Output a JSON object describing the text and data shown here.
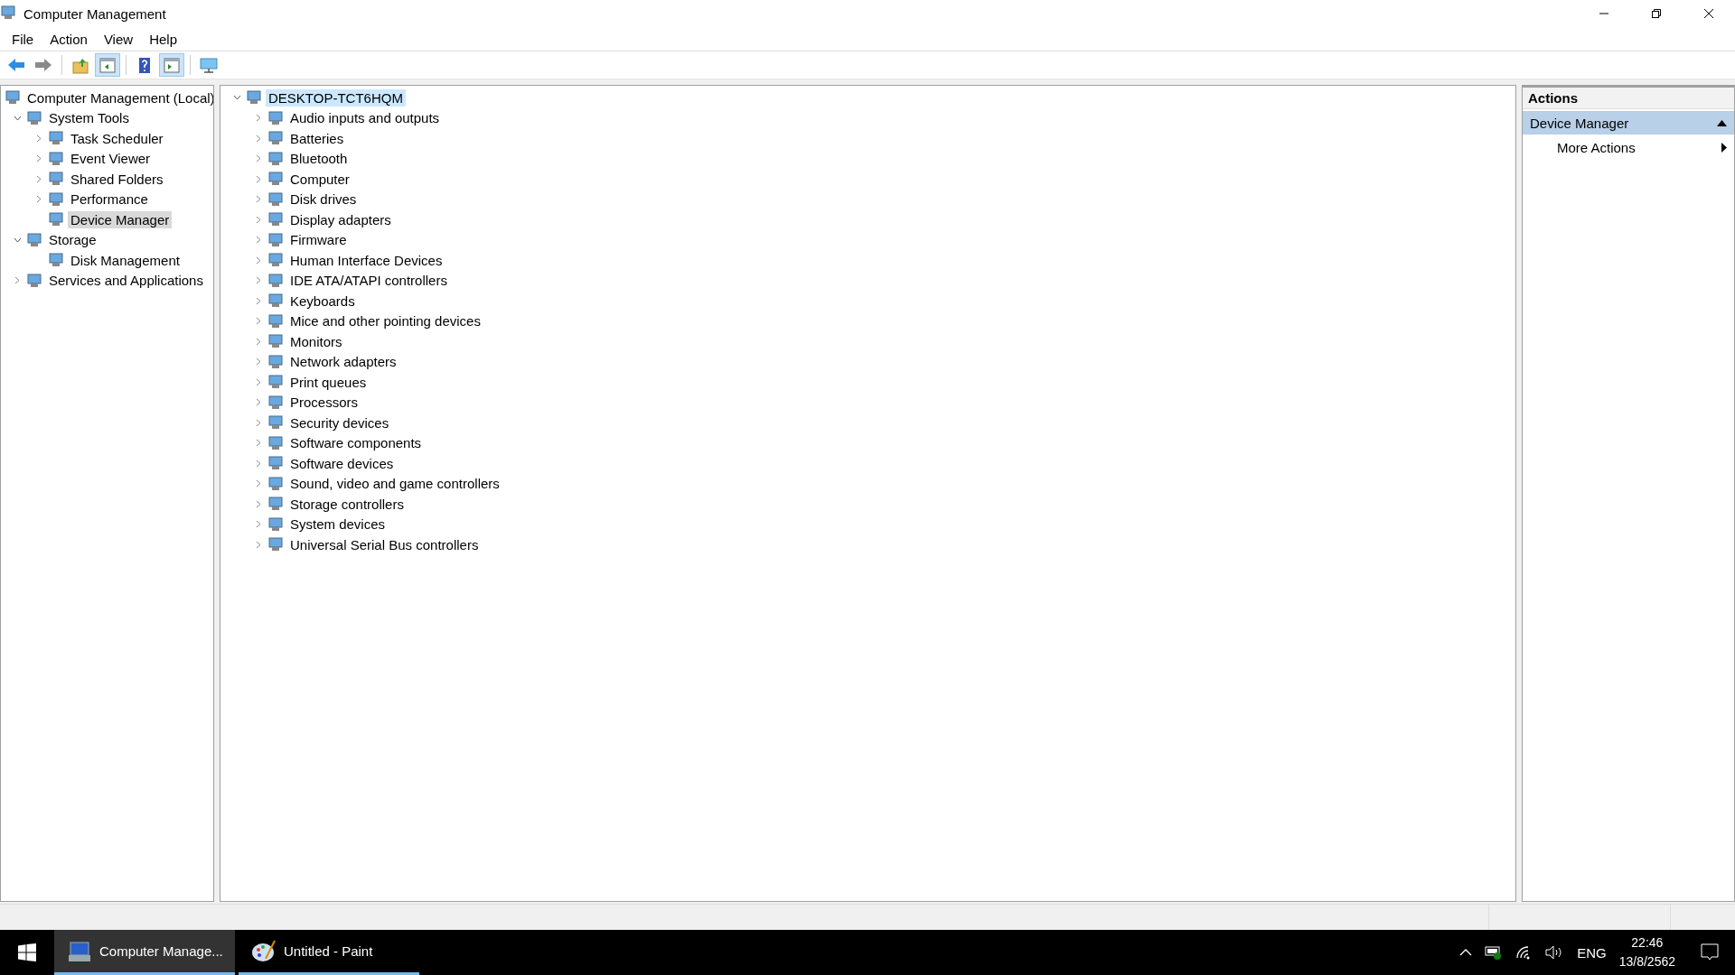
{
  "window": {
    "title": "Computer Management"
  },
  "menu": [
    "File",
    "Action",
    "View",
    "Help"
  ],
  "toolbar": [
    {
      "kind": "back",
      "pressed": false
    },
    {
      "kind": "forward",
      "pressed": false
    },
    {
      "kind": "up",
      "pressed": false
    },
    {
      "kind": "console-tree",
      "pressed": true
    },
    {
      "kind": "help",
      "pressed": false
    },
    {
      "kind": "action-pane",
      "pressed": true
    },
    {
      "kind": "monitor",
      "pressed": false
    }
  ],
  "console_tree": [
    {
      "label": "Computer Management (Local)",
      "selected": false,
      "children": [
        {
          "label": "System Tools",
          "expanded": true,
          "selected": false,
          "children": [
            {
              "label": "Task Scheduler",
              "expanded": false,
              "selected": false
            },
            {
              "label": "Event Viewer",
              "expanded": false,
              "selected": false
            },
            {
              "label": "Shared Folders",
              "expanded": false,
              "selected": false
            },
            {
              "label": "Performance",
              "expanded": false,
              "selected": false
            },
            {
              "label": "Device Manager",
              "selected": true
            }
          ]
        },
        {
          "label": "Storage",
          "expanded": true,
          "selected": false,
          "children": [
            {
              "label": "Disk Management",
              "selected": false
            }
          ]
        },
        {
          "label": "Services and Applications",
          "expanded": false,
          "selected": false
        }
      ]
    }
  ],
  "device_tree": [
    {
      "label": "DESKTOP-TCT6HQM",
      "expanded": true,
      "selected": true,
      "children": [
        {
          "label": "Audio inputs and outputs",
          "expanded": false,
          "selected": false
        },
        {
          "label": "Batteries",
          "expanded": false,
          "selected": false
        },
        {
          "label": "Bluetooth",
          "expanded": false,
          "selected": false
        },
        {
          "label": "Computer",
          "expanded": false,
          "selected": false
        },
        {
          "label": "Disk drives",
          "expanded": false,
          "selected": false
        },
        {
          "label": "Display adapters",
          "expanded": false,
          "selected": false
        },
        {
          "label": "Firmware",
          "expanded": false,
          "selected": false
        },
        {
          "label": "Human Interface Devices",
          "expanded": false,
          "selected": false
        },
        {
          "label": "IDE ATA/ATAPI controllers",
          "expanded": false,
          "selected": false
        },
        {
          "label": "Keyboards",
          "expanded": false,
          "selected": false
        },
        {
          "label": "Mice and other pointing devices",
          "expanded": false,
          "selected": false
        },
        {
          "label": "Monitors",
          "expanded": false,
          "selected": false
        },
        {
          "label": "Network adapters",
          "expanded": false,
          "selected": false
        },
        {
          "label": "Print queues",
          "expanded": false,
          "selected": false
        },
        {
          "label": "Processors",
          "expanded": false,
          "selected": false
        },
        {
          "label": "Security devices",
          "expanded": false,
          "selected": false
        },
        {
          "label": "Software components",
          "expanded": false,
          "selected": false
        },
        {
          "label": "Software devices",
          "expanded": false,
          "selected": false
        },
        {
          "label": "Sound, video and game controllers",
          "expanded": false,
          "selected": false
        },
        {
          "label": "Storage controllers",
          "expanded": false,
          "selected": false
        },
        {
          "label": "System devices",
          "expanded": false,
          "selected": false
        },
        {
          "label": "Universal Serial Bus controllers",
          "expanded": false,
          "selected": false
        }
      ]
    }
  ],
  "actions": {
    "title": "Actions",
    "section": {
      "label": "Device Manager",
      "expanded": true
    },
    "items": [
      "More Actions"
    ]
  },
  "taskbar": {
    "apps": [
      {
        "label": "Computer Manage...",
        "selected": true
      },
      {
        "label": "Untitled - Paint",
        "selected": false
      }
    ],
    "language": "ENG",
    "time": "22:46",
    "date": "13/8/2562"
  }
}
